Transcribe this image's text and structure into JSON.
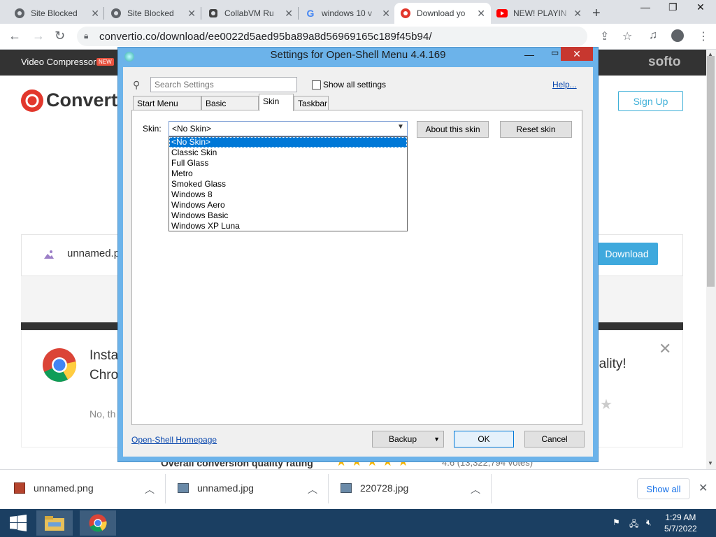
{
  "browser": {
    "tabs": [
      {
        "label": "Site Blocked",
        "icon": "globe-icon"
      },
      {
        "label": "Site Blocked",
        "icon": "globe-icon"
      },
      {
        "label": "CollabVM Ru",
        "icon": "collabvm-icon"
      },
      {
        "label": "windows 10 v",
        "icon": "google-icon"
      },
      {
        "label": "Download yo",
        "icon": "convertio-icon",
        "active": true
      },
      {
        "label": "NEW! PLAYIN",
        "icon": "youtube-icon"
      }
    ],
    "url": "convertio.co/download/ee0022d5aed95ba89a8d56969165c189f45b94/"
  },
  "page": {
    "nav_item": "Video Compressor",
    "new_badge": "NEW",
    "softo": "softo",
    "logo_text": "Convertio",
    "signup": "Sign Up",
    "file_name": "unnamed.p",
    "download": "Download",
    "promo_line1": "Insta",
    "promo_line2": "Chro",
    "promo_right": "uality!",
    "promo_decline": "No, th",
    "rating_label": "Overall conversion quality rating",
    "rating_value": "4.6",
    "rating_votes": "(13,322,794 votes)"
  },
  "downloads": {
    "items": [
      "unnamed.png",
      "unnamed.jpg",
      "220728.jpg"
    ],
    "show_all": "Show all"
  },
  "taskbar": {
    "time": "1:29 AM",
    "date": "5/7/2022"
  },
  "dialog": {
    "title": "Settings for Open-Shell Menu 4.4.169",
    "search_placeholder": "Search Settings",
    "show_all_label": "Show all settings",
    "help": "Help...",
    "tabs": [
      "Start Menu Style",
      "Basic Settings",
      "Skin",
      "Taskbar"
    ],
    "active_tab": "Skin",
    "skin_label": "Skin:",
    "skin_value": "<No Skin>",
    "about_button": "About this skin",
    "reset_button": "Reset skin",
    "skin_options": [
      "<No Skin>",
      "Classic Skin",
      "Full Glass",
      "Metro",
      "Smoked Glass",
      "Windows 8",
      "Windows Aero",
      "Windows Basic",
      "Windows XP Luna"
    ],
    "homepage_link": "Open-Shell Homepage",
    "backup_button": "Backup",
    "ok_button": "OK",
    "cancel_button": "Cancel"
  }
}
